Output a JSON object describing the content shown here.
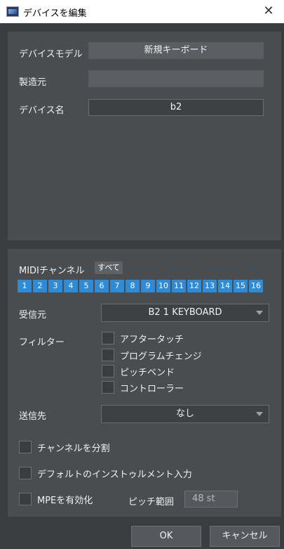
{
  "window": {
    "title": "デバイスを編集",
    "close_symbol": "✕"
  },
  "device": {
    "model_label": "デバイスモデル",
    "model_value": "新規キーボード",
    "manufacturer_label": "製造元",
    "manufacturer_value": "",
    "name_label": "デバイス名",
    "name_value": "b2"
  },
  "midi": {
    "channel_label": "MIDIチャンネル",
    "all_badge": "すべて",
    "channels": [
      "1",
      "2",
      "3",
      "4",
      "5",
      "6",
      "7",
      "8",
      "9",
      "10",
      "11",
      "12",
      "13",
      "14",
      "15",
      "16"
    ],
    "channel_color": "#2f8bd6",
    "receive_label": "受信元",
    "receive_value": "B2 1 KEYBOARD",
    "filter_label": "フィルター",
    "filters": [
      "アフタータッチ",
      "プログラムチェンジ",
      "ピッチベンド",
      "コントローラー"
    ],
    "send_label": "送信先",
    "send_value": "なし"
  },
  "options": {
    "split_channels": "チャンネルを分割",
    "default_instrument_input": "デフォルトのインストゥルメント入力",
    "enable_mpe": "MPEを有効化",
    "pitch_range_label": "ピッチ範囲",
    "pitch_range_value": "48 st"
  },
  "buttons": {
    "ok": "OK",
    "cancel": "キャンセル"
  }
}
